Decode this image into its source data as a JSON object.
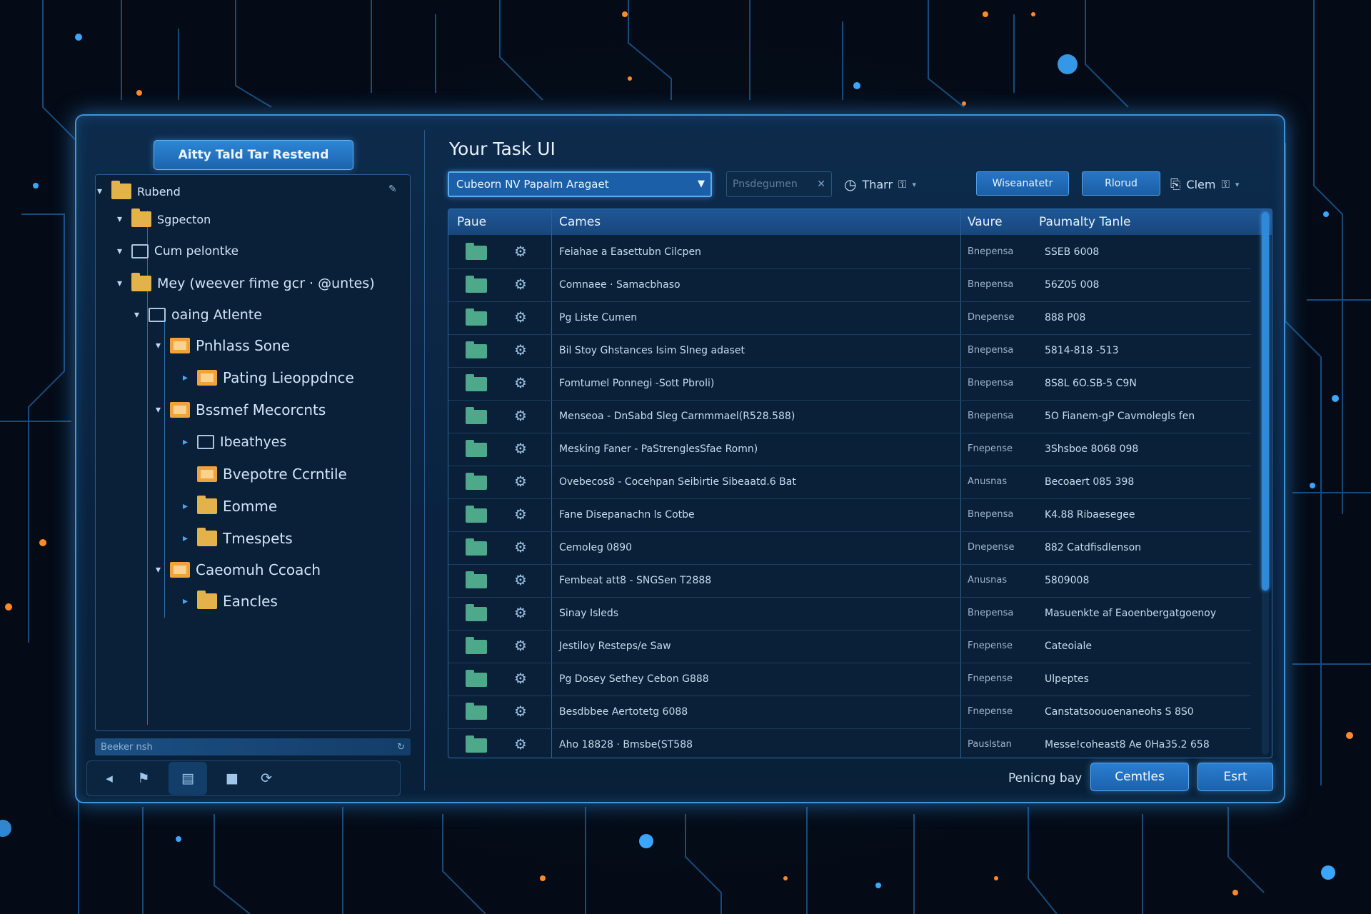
{
  "colors": {
    "accent": "#2f86d6",
    "window_border": "#3f95d6",
    "folder": "#e4b24a",
    "file_icon": "#4ea88a"
  },
  "left_panel": {
    "title": "Aitty Tald Tar Restend",
    "tree_items": [
      {
        "label": "Rubend",
        "expanded": true,
        "icon": "folder-icon"
      },
      {
        "label": "Sgpecton",
        "expanded": true,
        "icon": "folder-icon"
      },
      {
        "label": "Cum pelontke",
        "expanded": true,
        "icon": "folder-outline-icon"
      },
      {
        "label": "Mey (weever fime gcr · @untes)",
        "expanded": true,
        "icon": "folder-icon"
      },
      {
        "label": "oaing Atlente",
        "expanded": true,
        "icon": "folder-outline-icon"
      },
      {
        "label": "Pnhlass Sone",
        "expanded": true,
        "icon": "app-folder-icon"
      },
      {
        "label": "Pating Lieoppdnce",
        "expanded": false,
        "icon": "app-folder-icon"
      },
      {
        "label": "Bssmef Mecorcnts",
        "expanded": true,
        "icon": "app-folder-icon"
      },
      {
        "label": "Ibeathyes",
        "expanded": false,
        "icon": "folder-outline-icon"
      },
      {
        "label": "Bvepotre Ccrntile",
        "expanded": false,
        "icon": "app-folder-icon"
      },
      {
        "label": "Eomme",
        "expanded": false,
        "icon": "folder-icon"
      },
      {
        "label": "Tmespets",
        "expanded": false,
        "icon": "folder-icon"
      },
      {
        "label": "Caeomuh Ccoach",
        "expanded": true,
        "icon": "app-folder-icon"
      },
      {
        "label": "Eancles",
        "expanded": false,
        "icon": "folder-icon"
      }
    ],
    "footer_label": "Beeker nsh"
  },
  "main": {
    "title": "Your Task UI",
    "select_value": "Cubeorn NV Papalm Aragaet",
    "search_placeholder": "Pnsdegumen",
    "filter_label": "Tharr",
    "button_1": "Wiseanatetr",
    "button_2": "Rlorud",
    "clear_label": "Clem"
  },
  "table": {
    "columns": [
      "Paue",
      "Cames",
      "Vaure",
      "Paumalty Tanle"
    ],
    "rows": [
      {
        "name": "Feiahae a Easettubn Cilcpen",
        "type": "Bnepensa",
        "value": "SSEB 6008"
      },
      {
        "name": "Comnaee · Samacbhaso",
        "type": "Bnepensa",
        "value": "56Z05 008"
      },
      {
        "name": "Pg Liste Cumen",
        "type": "Dnepense",
        "value": "888 P08"
      },
      {
        "name": "Bil Stoy Ghstances Isim Slneg adaset",
        "type": "Bnepensa",
        "value": "5814-818 -513"
      },
      {
        "name": "Fomtumel Ponnegi -Sott Pbroli)",
        "type": "Bnepensa",
        "value": "8S8L 6O.SB-5 C9N"
      },
      {
        "name": "Menseoa - DnSabd Sleg Carnmmael(R528.588)",
        "type": "Bnepensa",
        "value": "5O Fianem-gP Cavmolegls fen"
      },
      {
        "name": "Mesking Faner - PaStrenglesSfae Romn)",
        "type": "Fnepense",
        "value": "3Shsboe 8068 098"
      },
      {
        "name": "Ovebecos8 - Cocehpan Seibirtie Sibeaatd.6 Bat",
        "type": "Anusnas",
        "value": "Becoaert 085 398"
      },
      {
        "name": "Fane Disepanachn ls Cotbe",
        "type": "Bnepensa",
        "value": "K4.88 Ribaesegee"
      },
      {
        "name": "Cemoleg 0890",
        "type": "Dnepense",
        "value": "882 Catdfisdlenson"
      },
      {
        "name": "Fembeat att8 - SNGSen T2888",
        "type": "Anusnas",
        "value": "5809008"
      },
      {
        "name": "Sinay Isleds",
        "type": "Bnepensa",
        "value": "Masuenkte af Eaoenbergatgoenoy"
      },
      {
        "name": "Jestiloy Resteps/e Saw",
        "type": "Fnepense",
        "value": "Cateoiale"
      },
      {
        "name": "Pg Dosey Sethey Cebon G888",
        "type": "Fnepense",
        "value": "Ulpeptes"
      },
      {
        "name": "Besdbbee Aertotetg 6088",
        "type": "Fnepense",
        "value": "Canstatsoouoenaneohs S 8S0"
      },
      {
        "name": "Aho 18828 · Bmsbe(ST588",
        "type": "Pauslstan",
        "value": "Messe!coheast8 Ae 0Ha35.2 658"
      }
    ]
  },
  "footer": {
    "label": "Penicng bay",
    "confirm_button": "Cemtles",
    "second_button": "Esrt"
  }
}
